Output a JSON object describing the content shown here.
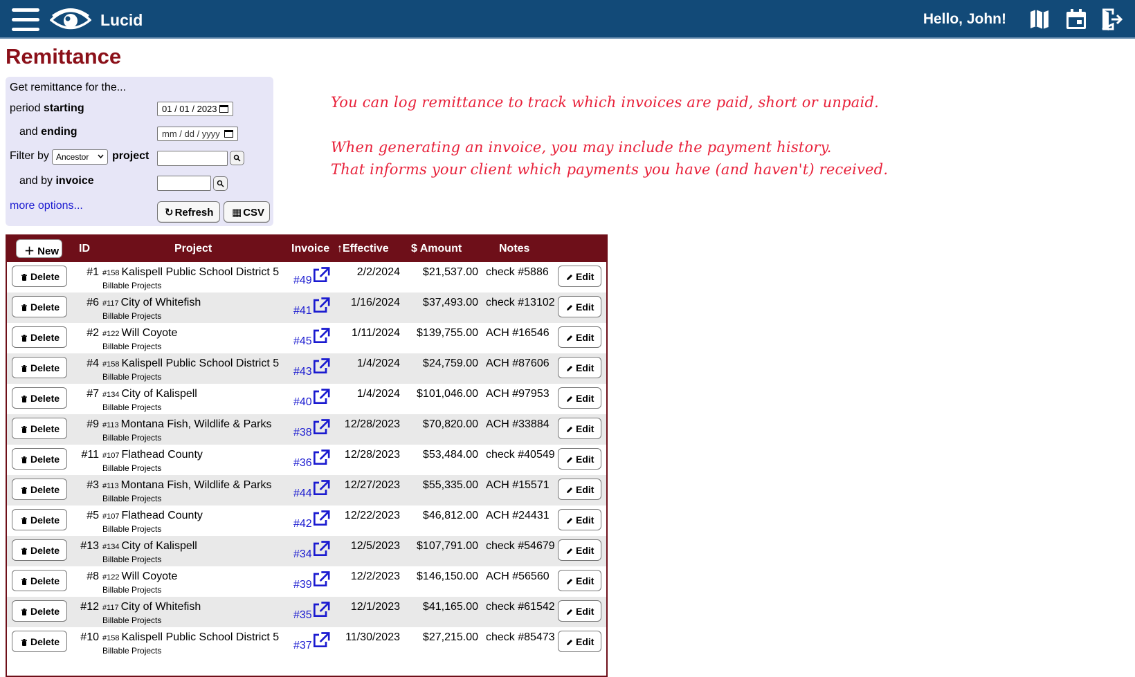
{
  "header": {
    "app_name": "Lucid",
    "greeting": "Hello, John!",
    "icons": [
      "menu-icon",
      "eye-logo-icon",
      "map-icon",
      "calendar-icon",
      "logout-icon"
    ],
    "bar_color": "#124a78"
  },
  "page": {
    "title": "Remittance",
    "title_color": "#8b1019"
  },
  "filter": {
    "intro": "Get remittance for the...",
    "period_prefix": "period ",
    "period_bold": "starting",
    "start_date": "01 / 01 / 2023",
    "ending_prefix": "and ",
    "ending_bold": "ending",
    "end_date": "mm / dd / yyyy",
    "filter_by": "Filter by",
    "relation_select": "Ancestor",
    "project_label": "project",
    "invoice_prefix": "and by ",
    "invoice_label": "invoice",
    "more_options": "more options...",
    "refresh_label": "Refresh",
    "csv_label": "CSV"
  },
  "hint": {
    "line1": "You can log remittance to track which invoices are paid, short or unpaid.",
    "line2": "When generating an invoice, you may include the payment history.",
    "line3": "That informs your client which payments you have (and haven't) received.",
    "color": "#e8213a"
  },
  "table": {
    "new_label": "New",
    "headers": {
      "id": "ID",
      "project": "Project",
      "invoice": "Invoice",
      "sort_arrow": "↑",
      "effective": "Effective",
      "amount": "$ Amount",
      "notes": "Notes"
    },
    "delete_label": "Delete",
    "edit_label": "Edit",
    "header_color": "#6e0f19",
    "rows": [
      {
        "id": "#1",
        "proj_num": "#158",
        "project": "Kalispell Public School District 5",
        "sub": "Billable Projects",
        "invoice": "#49",
        "effective": "2/2/2024",
        "amount": "$21,537.00",
        "notes": "check #5886"
      },
      {
        "id": "#6",
        "proj_num": "#117",
        "project": "City of Whitefish",
        "sub": "Billable Projects",
        "invoice": "#41",
        "effective": "1/16/2024",
        "amount": "$37,493.00",
        "notes": "check #13102"
      },
      {
        "id": "#2",
        "proj_num": "#122",
        "project": "Will Coyote",
        "sub": "Billable Projects",
        "invoice": "#45",
        "effective": "1/11/2024",
        "amount": "$139,755.00",
        "notes": "ACH #16546"
      },
      {
        "id": "#4",
        "proj_num": "#158",
        "project": "Kalispell Public School District 5",
        "sub": "Billable Projects",
        "invoice": "#43",
        "effective": "1/4/2024",
        "amount": "$24,759.00",
        "notes": "ACH #87606"
      },
      {
        "id": "#7",
        "proj_num": "#134",
        "project": "City of Kalispell",
        "sub": "Billable Projects",
        "invoice": "#40",
        "effective": "1/4/2024",
        "amount": "$101,046.00",
        "notes": "ACH #97953"
      },
      {
        "id": "#9",
        "proj_num": "#113",
        "project": "Montana Fish, Wildlife & Parks",
        "sub": "Billable Projects",
        "invoice": "#38",
        "effective": "12/28/2023",
        "amount": "$70,820.00",
        "notes": "ACH #33884"
      },
      {
        "id": "#11",
        "proj_num": "#107",
        "project": "Flathead County",
        "sub": "Billable Projects",
        "invoice": "#36",
        "effective": "12/28/2023",
        "amount": "$53,484.00",
        "notes": "check #40549"
      },
      {
        "id": "#3",
        "proj_num": "#113",
        "project": "Montana Fish, Wildlife & Parks",
        "sub": "Billable Projects",
        "invoice": "#44",
        "effective": "12/27/2023",
        "amount": "$55,335.00",
        "notes": "ACH #15571"
      },
      {
        "id": "#5",
        "proj_num": "#107",
        "project": "Flathead County",
        "sub": "Billable Projects",
        "invoice": "#42",
        "effective": "12/22/2023",
        "amount": "$46,812.00",
        "notes": "ACH #24431"
      },
      {
        "id": "#13",
        "proj_num": "#134",
        "project": "City of Kalispell",
        "sub": "Billable Projects",
        "invoice": "#34",
        "effective": "12/5/2023",
        "amount": "$107,791.00",
        "notes": "check #54679"
      },
      {
        "id": "#8",
        "proj_num": "#122",
        "project": "Will Coyote",
        "sub": "Billable Projects",
        "invoice": "#39",
        "effective": "12/2/2023",
        "amount": "$146,150.00",
        "notes": "ACH #56560"
      },
      {
        "id": "#12",
        "proj_num": "#117",
        "project": "City of Whitefish",
        "sub": "Billable Projects",
        "invoice": "#35",
        "effective": "12/1/2023",
        "amount": "$41,165.00",
        "notes": "check #61542"
      },
      {
        "id": "#10",
        "proj_num": "#158",
        "project": "Kalispell Public School District 5",
        "sub": "Billable Projects",
        "invoice": "#37",
        "effective": "11/30/2023",
        "amount": "$27,215.00",
        "notes": "check #85473"
      }
    ]
  }
}
